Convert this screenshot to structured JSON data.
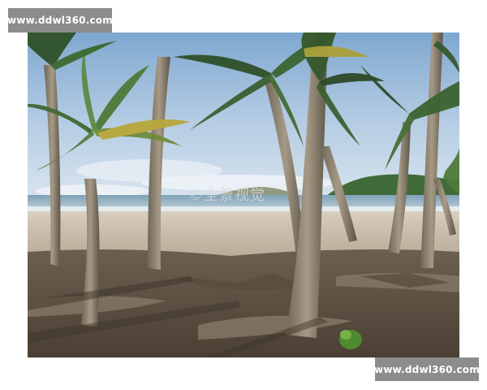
{
  "watermarks": {
    "top_left": "www.ddwl360.com",
    "bottom_right": "www.ddwl360.com",
    "center": "©全景视觉"
  },
  "scene": {
    "subject": "beach-with-palm-trees"
  }
}
